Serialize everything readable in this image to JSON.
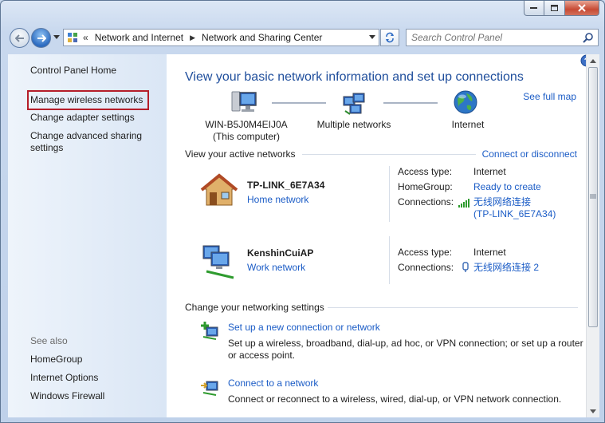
{
  "address": {
    "crumbs": [
      "Network and Internet",
      "Network and Sharing Center"
    ],
    "overflow": "«",
    "separator": "▶"
  },
  "search": {
    "placeholder": "Search Control Panel"
  },
  "sidebar": {
    "home": "Control Panel Home",
    "items": [
      {
        "label": "Manage wireless networks"
      },
      {
        "label": "Change adapter settings"
      },
      {
        "label": "Change advanced sharing settings"
      }
    ],
    "see_also": "See also",
    "see_also_items": [
      "HomeGroup",
      "Internet Options",
      "Windows Firewall"
    ]
  },
  "main": {
    "title": "View your basic network information and set up connections",
    "see_full_map": "See full map",
    "map": {
      "computer": "WIN-B5J0M4EIJ0A",
      "computer_sub": "(This computer)",
      "networks": "Multiple networks",
      "internet": "Internet"
    },
    "active_header": "View your active networks",
    "connect_disconnect": "Connect or disconnect",
    "networks": [
      {
        "name": "TP-LINK_6E7A34",
        "type": "Home network",
        "access_label": "Access type:",
        "access_value": "Internet",
        "homegroup_label": "HomeGroup:",
        "homegroup_value": "Ready to create",
        "connections_label": "Connections:",
        "connection_value": "无线网络连接",
        "connection_sub": "(TP-LINK_6E7A34)"
      },
      {
        "name": "KenshinCuiAP",
        "type": "Work network",
        "access_label": "Access type:",
        "access_value": "Internet",
        "connections_label": "Connections:",
        "connection_value": "无线网络连接 2"
      }
    ],
    "settings_header": "Change your networking settings",
    "tasks": [
      {
        "title": "Set up a new connection or network",
        "desc": "Set up a wireless, broadband, dial-up, ad hoc, or VPN connection; or set up a router or access point."
      },
      {
        "title": "Connect to a network",
        "desc": "Connect or reconnect to a wireless, wired, dial-up, or VPN network connection."
      }
    ]
  },
  "colors": {
    "link": "#1b5cc6",
    "title": "#1f4e9c",
    "highlight_box": "#b51e2a"
  }
}
